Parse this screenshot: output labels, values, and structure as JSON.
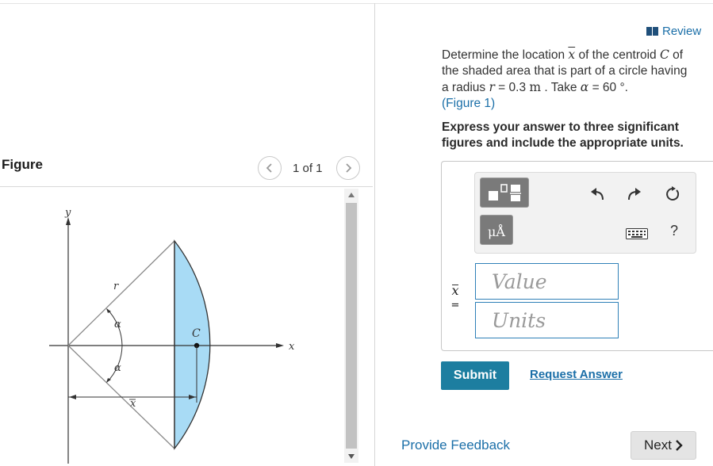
{
  "header": {
    "review_label": "Review"
  },
  "problem": {
    "t1": "Determine the location ",
    "var_xbar": "x",
    "t2": " of the centroid ",
    "var_c": "C",
    "t3": " of the shaded area that is part of a circle having a radius ",
    "var_r": "r",
    "t4": " = 0.3 ",
    "unit_m": "m",
    "t5": " . Take ",
    "var_alpha": "α",
    "t6": " = 60 °.",
    "figure_link": "(Figure 1)"
  },
  "instructions": "Express your answer to three significant figures and include the appropriate units.",
  "figure_panel": {
    "title": "Figure",
    "page_indicator": "1 of 1",
    "labels": {
      "y": "y",
      "x": "x",
      "r": "r",
      "alpha_top": "α",
      "alpha_bottom": "α",
      "c": "C",
      "xbar": "x"
    }
  },
  "answer": {
    "variable_label": "x",
    "equals": "=",
    "value_placeholder": "Value",
    "units_placeholder": "Units",
    "units_button_label": "μÅ",
    "help_label": "?"
  },
  "actions": {
    "submit_label": "Submit",
    "request_answer_label": "Request Answer",
    "feedback_label": "Provide Feedback",
    "next_label": "Next"
  },
  "colors": {
    "link": "#1b6fa8",
    "submit": "#1d7ea0",
    "shaded_area": "#a8dbf5"
  }
}
